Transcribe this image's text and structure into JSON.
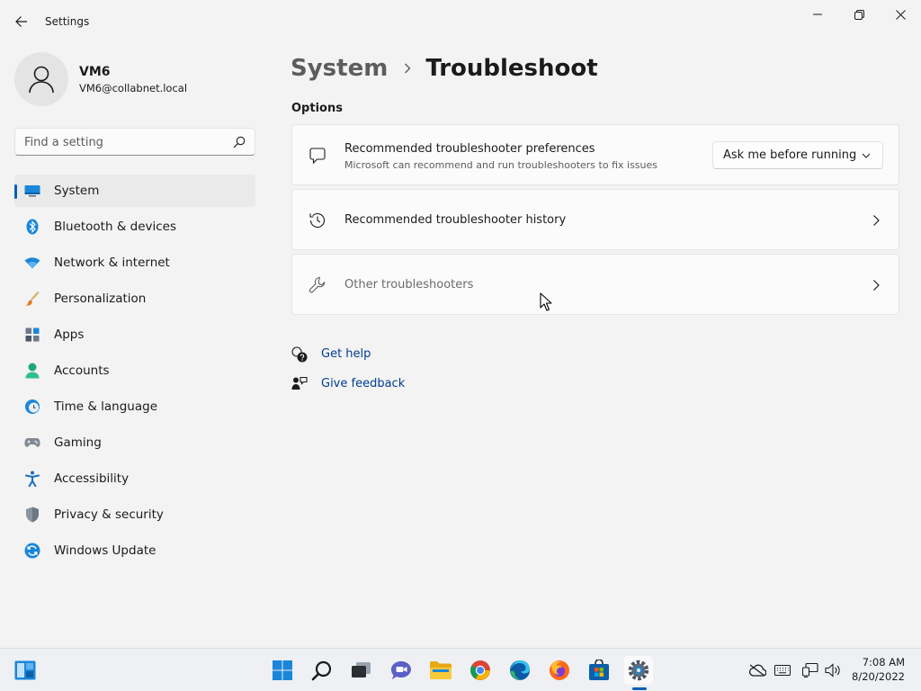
{
  "window": {
    "title": "Settings"
  },
  "user": {
    "name": "VM6",
    "email": "VM6@collabnet.local"
  },
  "search": {
    "placeholder": "Find a setting"
  },
  "sidebar": {
    "selected": "System",
    "items": [
      {
        "label": "System",
        "icon": "system-icon"
      },
      {
        "label": "Bluetooth & devices",
        "icon": "bluetooth-icon"
      },
      {
        "label": "Network & internet",
        "icon": "wifi-icon"
      },
      {
        "label": "Personalization",
        "icon": "brush-icon"
      },
      {
        "label": "Apps",
        "icon": "apps-icon"
      },
      {
        "label": "Accounts",
        "icon": "person-icon"
      },
      {
        "label": "Time & language",
        "icon": "clock-globe-icon"
      },
      {
        "label": "Gaming",
        "icon": "gamepad-icon"
      },
      {
        "label": "Accessibility",
        "icon": "accessibility-icon"
      },
      {
        "label": "Privacy & security",
        "icon": "shield-icon"
      },
      {
        "label": "Windows Update",
        "icon": "update-icon"
      }
    ]
  },
  "breadcrumb": {
    "parent": "System",
    "current": "Troubleshoot"
  },
  "options": {
    "section_title": "Options",
    "cards": [
      {
        "title": "Recommended troubleshooter preferences",
        "subtitle": "Microsoft can recommend and run troubleshooters to fix issues",
        "icon": "chat-bubble-icon",
        "dropdown_value": "Ask me before running"
      },
      {
        "title": "Recommended troubleshooter history",
        "icon": "history-icon"
      },
      {
        "title": "Other troubleshooters",
        "icon": "wrench-icon"
      }
    ]
  },
  "links": {
    "get_help": "Get help",
    "give_feedback": "Give feedback"
  },
  "taskbar": {
    "apps": [
      "start-icon",
      "search-icon",
      "task-view-icon",
      "chat-icon",
      "file-explorer-icon",
      "chrome-icon",
      "edge-icon",
      "firefox-icon",
      "store-icon",
      "settings-icon"
    ],
    "active_app": "settings-icon",
    "clock": {
      "time": "7:08 AM",
      "date": "8/20/2022"
    }
  },
  "colors": {
    "accent": "#005fb8",
    "link": "#003e92",
    "background": "#f3f3f3",
    "card": "#fbfbfb"
  }
}
